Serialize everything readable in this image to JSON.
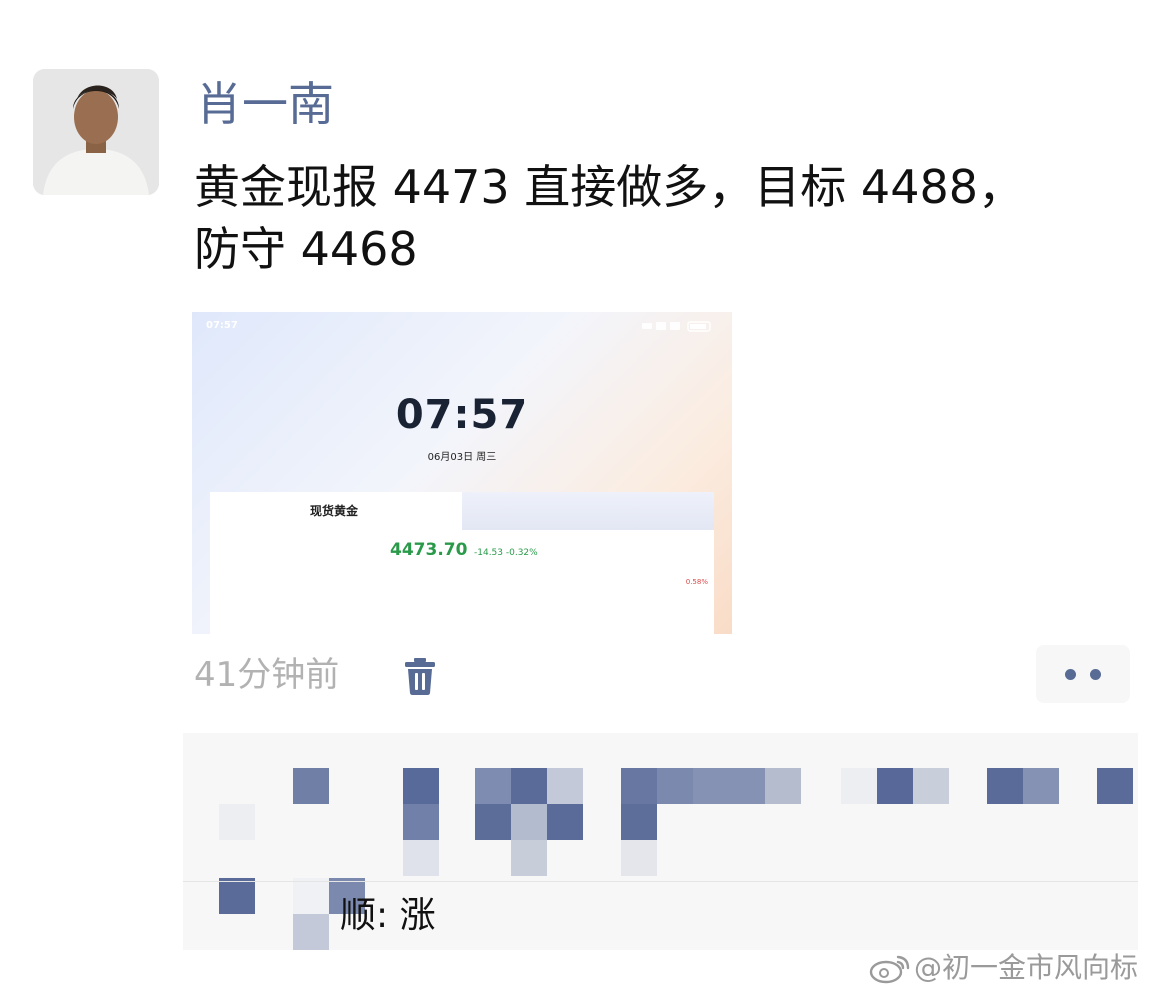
{
  "post": {
    "author": "肖一南",
    "text_line1": "黄金现报 4473 直接做多，目标 4488，",
    "text_line2": "防守 4468",
    "time_ago": "41分钟前"
  },
  "screenshot": {
    "status_time": "07:57",
    "clock": "07:57",
    "date": "06月03日 周三",
    "card_title": "现货黄金",
    "price": "4473.70",
    "change": "-14.53  -0.32%",
    "side_pct": "0.58%"
  },
  "comment": {
    "visible_text": "顺: 涨"
  },
  "watermark": "@初一金市风向标",
  "colors": {
    "author_link": "#576b95",
    "price_green": "#2a9a4a",
    "meta_gray": "#b2b2b2"
  },
  "icons": [
    "trash-icon",
    "more-dots-icon",
    "weibo-icon"
  ]
}
